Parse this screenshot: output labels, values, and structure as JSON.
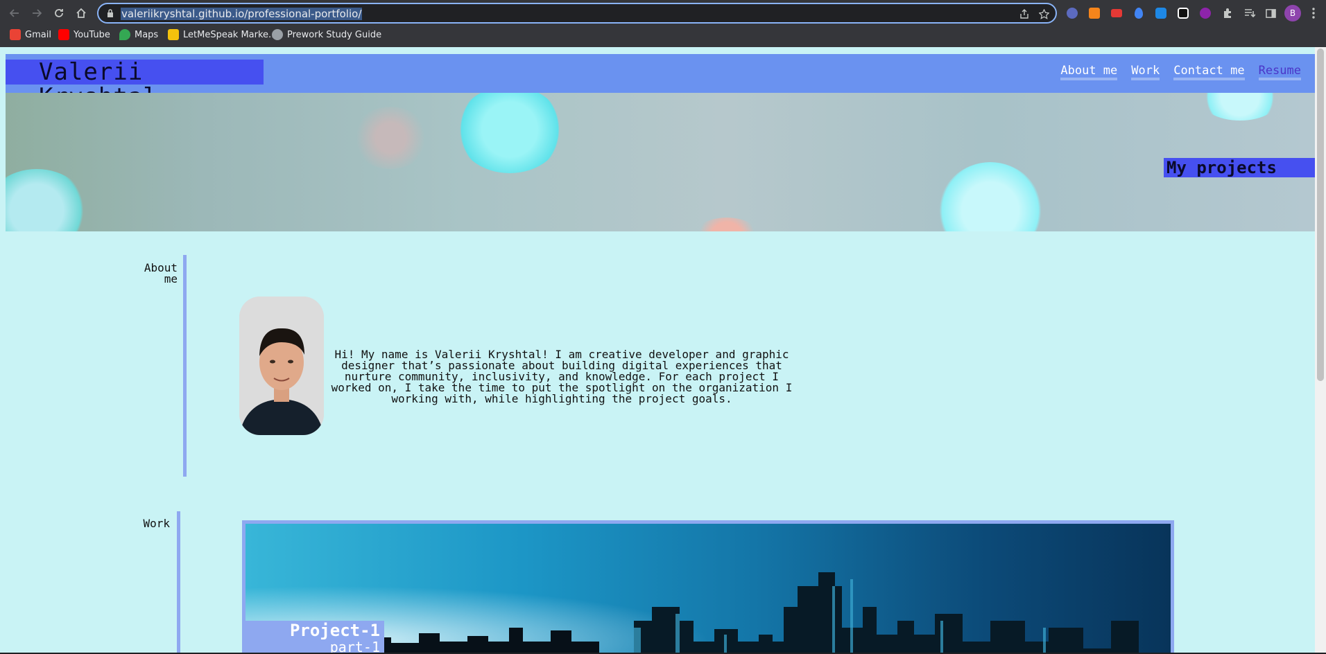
{
  "browser": {
    "url": "valeriikryshtal.github.io/professional-portfolio/",
    "profile_initial": "B",
    "bookmarks": [
      {
        "label": "Gmail",
        "color": "#ea4335"
      },
      {
        "label": "YouTube",
        "color": "#ff0000"
      },
      {
        "label": "Maps",
        "color": "#34a853"
      },
      {
        "label": "LetMeSpeak Marke...",
        "color": "#f4c20d"
      },
      {
        "label": "Prework Study Guide",
        "color": "#9aa0a6"
      }
    ]
  },
  "site": {
    "name": "Valerii Kryshtal",
    "nav": [
      "About me",
      "Work",
      "Contact me",
      "Resume"
    ],
    "hero_label": "My projects",
    "about": {
      "title": "About me",
      "text": "Hi! My name is Valerii Kryshtal! I am creative developer and graphic designer that’s passionate about building digital experiences that nurture community, inclusivity, and knowledge. For each project I worked on, I take the time to put the spotlight on the organization I working with, while highlighting the project goals."
    },
    "work": {
      "title": "Work",
      "project_title": "Project-1",
      "project_sub": "part-1"
    }
  },
  "colors": {
    "header": "#6a92f0",
    "accent": "#4650f0",
    "page_bg": "#c9f3f5",
    "bar": "#8ea8f0"
  }
}
